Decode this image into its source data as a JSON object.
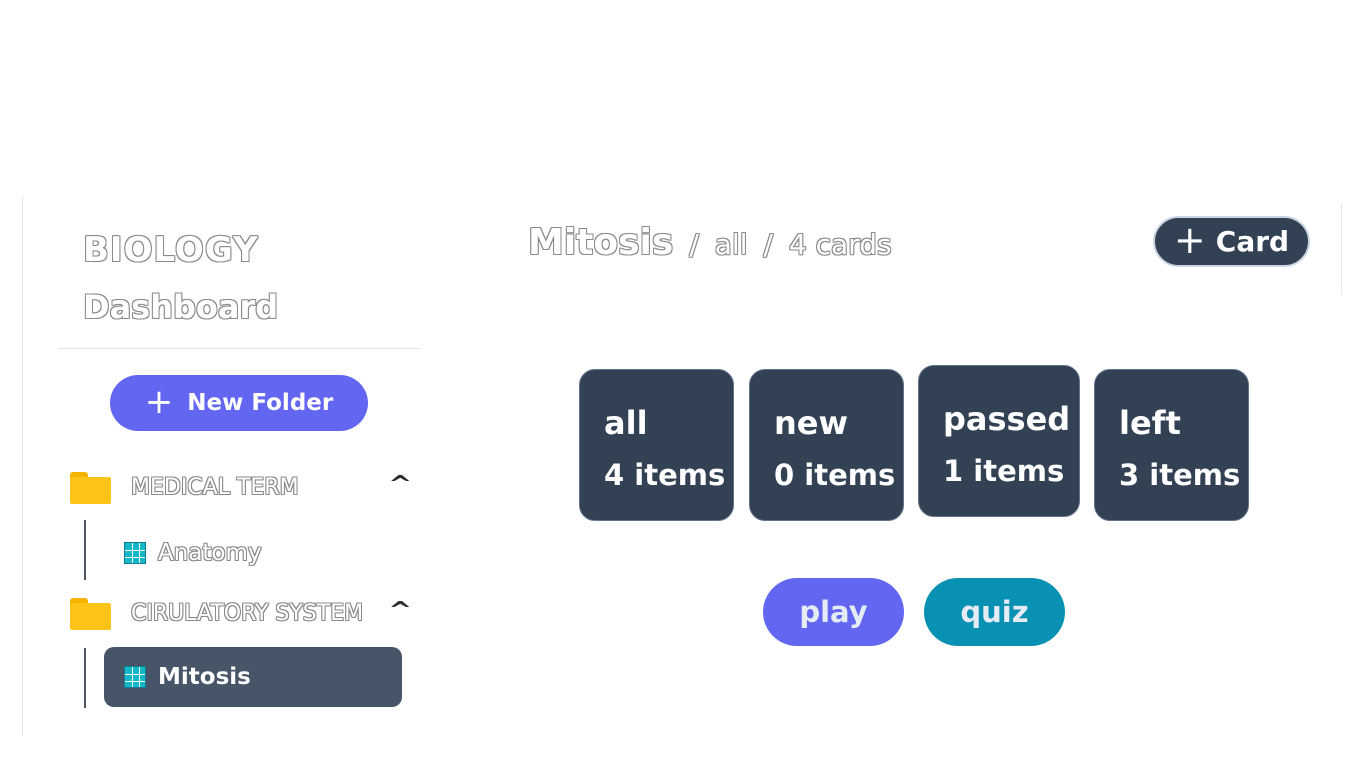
{
  "sidebar": {
    "title": "BIOLOGY",
    "subtitle": "Dashboard",
    "new_folder_label": "New Folder",
    "folders": [
      {
        "label": "MEDICAL TERM",
        "expanded": true,
        "icon": "folder-icon",
        "decks": [
          {
            "label": "Anatomy",
            "icon": "grid-icon",
            "active": false
          }
        ]
      },
      {
        "label": "CIRULATORY SYSTEM",
        "expanded": true,
        "icon": "folder-icon",
        "decks": [
          {
            "label": "Mitosis",
            "icon": "grid-icon",
            "active": true
          }
        ]
      }
    ]
  },
  "header": {
    "deck_name": "Mitosis",
    "separator": "/",
    "filter": "all",
    "count_label": "4 cards",
    "add_card_label": "Card"
  },
  "stats": [
    {
      "title": "all",
      "count": "4 items"
    },
    {
      "title": "new",
      "count": "0 items"
    },
    {
      "title": "passed",
      "count": "1 items"
    },
    {
      "title": "left",
      "count": "3 items"
    }
  ],
  "actions": {
    "play_label": "play",
    "quiz_label": "quiz"
  },
  "colors": {
    "accent": "#6366f1",
    "quiz": "#0891b2",
    "card_bg": "#334155",
    "active_item": "#475569",
    "folder": "#fcc419"
  }
}
